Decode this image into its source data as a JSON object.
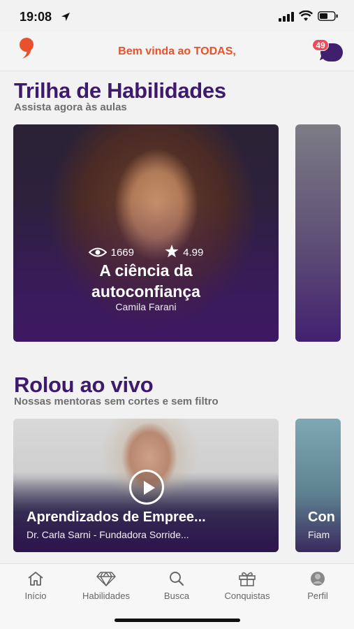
{
  "status_bar": {
    "time": "19:08"
  },
  "header": {
    "welcome": "Bem vinda ao TODAS,",
    "chat_badge": "49"
  },
  "trilha": {
    "title": "Trilha de Habilidades",
    "subtitle": "Assista agora às aulas",
    "cards": [
      {
        "views": "1669",
        "rating": "4.99",
        "title": "A ciência da autoconfiança",
        "author": "Camila Farani"
      }
    ]
  },
  "rolou": {
    "title": "Rolou ao vivo",
    "subtitle": "Nossas mentoras sem cortes e sem filtro",
    "cards": [
      {
        "title": "Aprendizados de Empree...",
        "author": "Dr. Carla Sarni - Fundadora Sorride..."
      },
      {
        "title": "Con",
        "author": "Fiam"
      }
    ]
  },
  "tabs": [
    {
      "label": "Início",
      "icon": "home-icon"
    },
    {
      "label": "Habilidades",
      "icon": "diamond-icon"
    },
    {
      "label": "Busca",
      "icon": "search-icon"
    },
    {
      "label": "Conquistas",
      "icon": "gift-icon"
    },
    {
      "label": "Perfil",
      "icon": "profile-icon"
    }
  ],
  "colors": {
    "accent": "#e8512b",
    "brand_purple": "#3d1a6b",
    "badge": "#f04a5c"
  }
}
